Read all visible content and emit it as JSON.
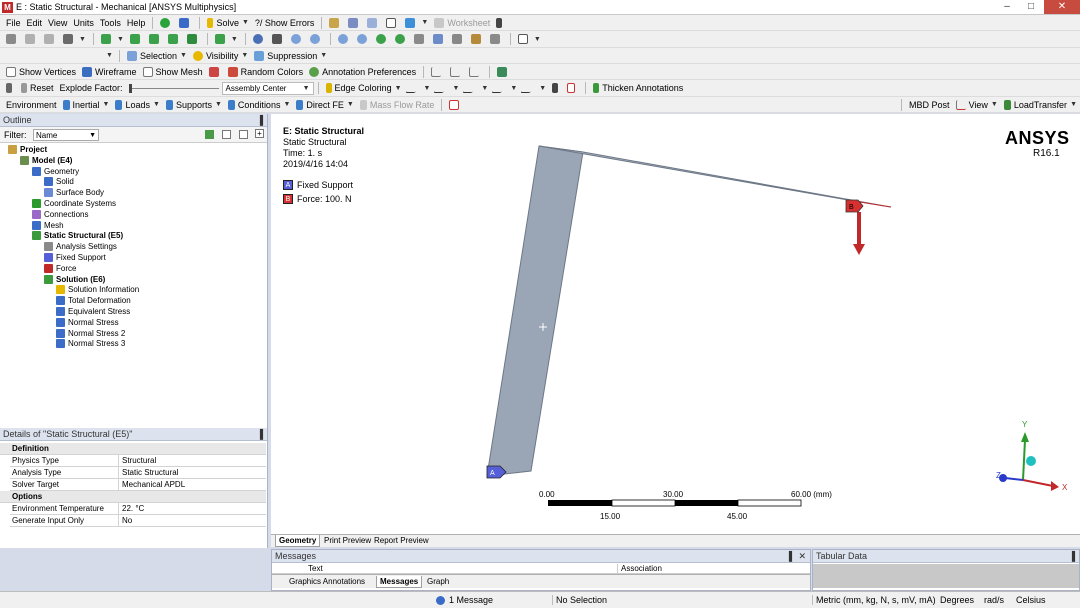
{
  "window": {
    "title": "E : Static Structural - Mechanical [ANSYS Multiphysics]",
    "app_icon": "mechanical-app-icon",
    "minimize": "–",
    "maximize": "□",
    "close": "✕"
  },
  "menu": [
    "File",
    "Edit",
    "View",
    "Units",
    "Tools",
    "Help"
  ],
  "toolbar1": {
    "solve": "Solve",
    "show_errors": "?/ Show Errors",
    "worksheet": "Worksheet"
  },
  "toolbar3": {
    "selection": "Selection",
    "visibility": "Visibility",
    "suppression": "Suppression"
  },
  "toolbar4": {
    "show_vertices": "Show Vertices",
    "wireframe": "Wireframe",
    "show_mesh": "Show Mesh",
    "random_colors": "Random Colors",
    "annotation_preferences": "Annotation Preferences"
  },
  "toolbar5": {
    "reset": "Reset",
    "explode_factor": "Explode Factor:",
    "assembly_center": "Assembly Center",
    "edge_coloring": "Edge Coloring",
    "thicken_annotations": "Thicken Annotations"
  },
  "context_toolbar": {
    "environment": "Environment",
    "inertial": "Inertial",
    "loads": "Loads",
    "supports": "Supports",
    "conditions": "Conditions",
    "direct_fe": "Direct FE",
    "mass_flow_rate": "Mass Flow Rate",
    "mbd_post": "MBD Post",
    "view": "View",
    "load_transfer": "LoadTransfer"
  },
  "outline": {
    "header": "Outline",
    "pin": "▐",
    "filter_label": "Filter:",
    "filter_value": "Name",
    "tree": [
      {
        "label": "Project",
        "level": 0,
        "bold": true,
        "icon": "project-icon"
      },
      {
        "label": "Model (E4)",
        "level": 1,
        "bold": true,
        "icon": "model-icon"
      },
      {
        "label": "Geometry",
        "level": 2,
        "bold": false,
        "icon": "geometry-icon"
      },
      {
        "label": "Solid",
        "level": 3,
        "bold": false,
        "icon": "solid-body-icon"
      },
      {
        "label": "Surface Body",
        "level": 3,
        "bold": false,
        "icon": "surface-body-icon"
      },
      {
        "label": "Coordinate Systems",
        "level": 2,
        "bold": false,
        "icon": "coordinate-systems-icon"
      },
      {
        "label": "Connections",
        "level": 2,
        "bold": false,
        "icon": "connections-icon"
      },
      {
        "label": "Mesh",
        "level": 2,
        "bold": false,
        "icon": "mesh-icon"
      },
      {
        "label": "Static Structural (E5)",
        "level": 2,
        "bold": true,
        "icon": "static-structural-icon"
      },
      {
        "label": "Analysis Settings",
        "level": 3,
        "bold": false,
        "icon": "analysis-settings-icon"
      },
      {
        "label": "Fixed Support",
        "level": 3,
        "bold": false,
        "icon": "fixed-support-icon"
      },
      {
        "label": "Force",
        "level": 3,
        "bold": false,
        "icon": "force-icon"
      },
      {
        "label": "Solution (E6)",
        "level": 3,
        "bold": true,
        "icon": "solution-icon"
      },
      {
        "label": "Solution Information",
        "level": 4,
        "bold": false,
        "icon": "solution-information-icon"
      },
      {
        "label": "Total Deformation",
        "level": 4,
        "bold": false,
        "icon": "result-icon"
      },
      {
        "label": "Equivalent Stress",
        "level": 4,
        "bold": false,
        "icon": "result-icon"
      },
      {
        "label": "Normal Stress",
        "level": 4,
        "bold": false,
        "icon": "result-icon"
      },
      {
        "label": "Normal Stress 2",
        "level": 4,
        "bold": false,
        "icon": "result-icon"
      },
      {
        "label": "Normal Stress 3",
        "level": 4,
        "bold": false,
        "icon": "result-icon"
      }
    ]
  },
  "details": {
    "header": "Details of \"Static Structural (E5)\"",
    "sections": [
      {
        "title": "Definition",
        "rows": [
          {
            "key": "Physics Type",
            "value": "Structural"
          },
          {
            "key": "Analysis Type",
            "value": "Static Structural"
          },
          {
            "key": "Solver Target",
            "value": "Mechanical APDL"
          }
        ]
      },
      {
        "title": "Options",
        "rows": [
          {
            "key": "Environment Temperature",
            "value": "22. °C"
          },
          {
            "key": "Generate Input Only",
            "value": "No"
          }
        ]
      }
    ]
  },
  "viewport": {
    "info_title": "E: Static Structural",
    "info_type": "Static Structural",
    "info_time": "Time: 1. s",
    "info_date": "2019/4/16 14:04",
    "legend": [
      {
        "tag": "A",
        "label": "Fixed Support",
        "color": "#5560d8"
      },
      {
        "tag": "B",
        "label": "Force: 100. N",
        "color": "#d63030"
      }
    ],
    "brand": "ANSYS",
    "version": "R16.1",
    "scale_top": [
      "0.00",
      "30.00",
      "60.00 (mm)"
    ],
    "scale_bottom": [
      "15.00",
      "45.00"
    ],
    "marker_a": "A",
    "marker_b": "B",
    "triad_y": "Y",
    "triad_z": "Z",
    "triad_x": "X"
  },
  "viewport_tabs": [
    "Geometry",
    "Print Preview",
    "Report Preview"
  ],
  "messages": {
    "header": "Messages",
    "col_text": "Text",
    "col_association": "Association",
    "tabs": [
      "Graphics Annotations",
      "Messages",
      "Graph"
    ],
    "active_tab": "Messages"
  },
  "tabular": {
    "header": "Tabular Data"
  },
  "status": {
    "messages": "1 Message",
    "selection": "No Selection",
    "units": "Metric (mm, kg, N, s, mV, mA)",
    "angle": "Degrees",
    "velocity": "rad/s",
    "temperature": "Celsius"
  },
  "colors": {
    "body_fill": "#9aa6b6",
    "body_edge": "#6d7786",
    "fixed_support": "#5560d8",
    "force": "#c0282a"
  }
}
